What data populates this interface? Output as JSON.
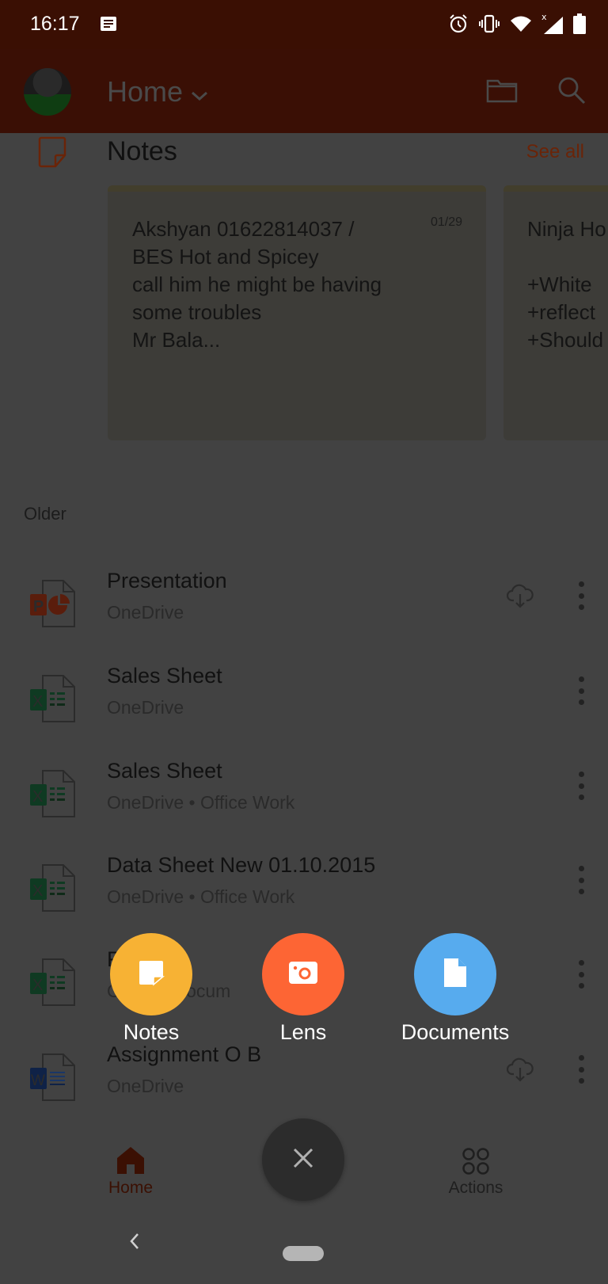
{
  "status_bar": {
    "time": "16:17",
    "icons": [
      "notification-icon",
      "alarm-icon",
      "vibrate-icon",
      "wifi-icon",
      "signal-icon",
      "battery-icon"
    ]
  },
  "app_bar": {
    "title": "Home",
    "icons": [
      "avatar",
      "folder-icon",
      "search-icon"
    ]
  },
  "notes": {
    "title": "Notes",
    "see_all": "See all",
    "cards": [
      {
        "text": "Akshyan 01622814037 /\nBES Hot and Spicey\ncall him he might be having\nsome troubles\nMr Bala...",
        "date": "01/29"
      },
      {
        "text": "Ninja Ho\n\n+White\n+reflect\n+Should",
        "date": ""
      }
    ]
  },
  "section_label": "Older",
  "files": [
    {
      "name": "Presentation",
      "location": "OneDrive",
      "type": "powerpoint",
      "cloud": true
    },
    {
      "name": "Sales Sheet",
      "location": "OneDrive",
      "type": "excel",
      "cloud": false
    },
    {
      "name": "Sales Sheet",
      "location": "OneDrive • Office Work",
      "type": "excel",
      "cloud": false
    },
    {
      "name": "Data Sheet New 01.10.2015",
      "location": "OneDrive • Office Work",
      "type": "excel",
      "cloud": false
    },
    {
      "name": "F",
      "location": "O        • Docum",
      "type": "excel",
      "cloud": false
    },
    {
      "name": "Assignment O B",
      "location": "OneDrive",
      "type": "word",
      "cloud": true
    }
  ],
  "fab_menu": {
    "options": [
      {
        "label": "Notes",
        "color": "#f7b234"
      },
      {
        "label": "Lens",
        "color": "#fd6534"
      },
      {
        "label": "Documents",
        "color": "#57abee"
      }
    ]
  },
  "bottom_nav": {
    "home": "Home",
    "actions": "Actions"
  },
  "colors": {
    "accent": "#c1441c",
    "scrim": "#424242",
    "excel": "#1d6f42",
    "word": "#2b579a",
    "powerpoint": "#c43e1c"
  }
}
